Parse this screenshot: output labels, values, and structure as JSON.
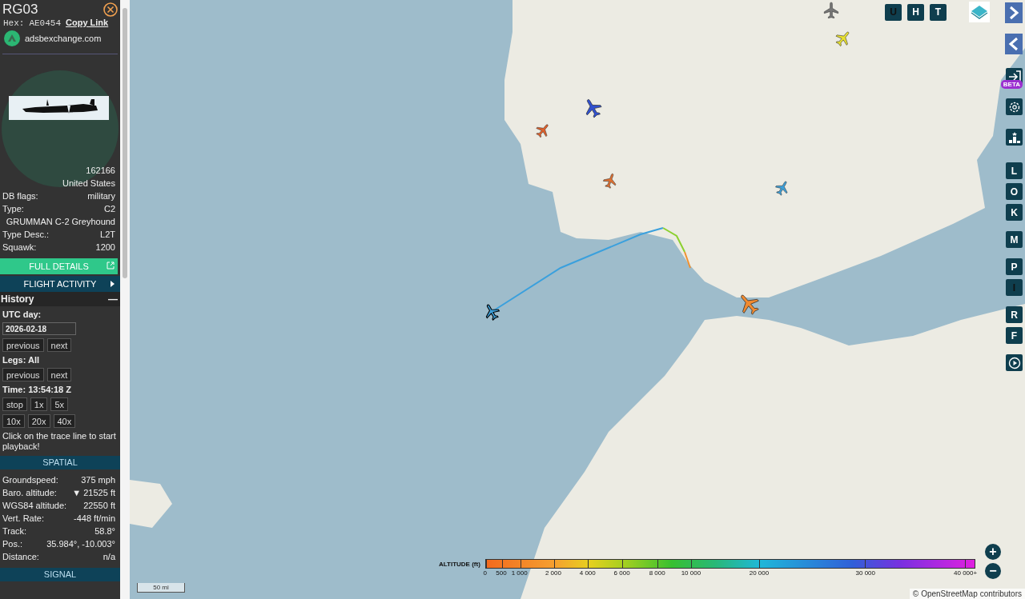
{
  "aircraft": {
    "callsign": "RG03",
    "hex_label": "Hex:",
    "hex": "AE0454",
    "copy_link": "Copy Link",
    "source": "adsbexchange.com"
  },
  "details": [
    {
      "value": "162166"
    },
    {
      "value": "United States"
    },
    {
      "label": "DB flags:",
      "value": "military"
    },
    {
      "label": "Type:",
      "value": "C2"
    },
    {
      "value": "GRUMMAN C-2 Greyhound"
    },
    {
      "label": "Type Desc.:",
      "value": "L2T"
    },
    {
      "label": "Squawk:",
      "value": "1200"
    }
  ],
  "full_details": "FULL DETAILS",
  "flight_activity": "FLIGHT ACTIVITY",
  "history": {
    "title": "History",
    "collapse": "—",
    "utc_label": "UTC day:",
    "date": "2026-02-18",
    "day_buttons": [
      "previous",
      "next"
    ],
    "legs": "Legs: All",
    "leg_buttons": [
      "previous",
      "next"
    ],
    "time": "Time: 13:54:18 Z",
    "speed_rows": [
      [
        "stop",
        "1x",
        "5x"
      ],
      [
        "10x",
        "20x",
        "40x"
      ]
    ],
    "hint": "Click on the trace line to start playback!"
  },
  "spatial": {
    "title": "SPATIAL",
    "rows": [
      {
        "label": "Groundspeed:",
        "value": "375 mph"
      },
      {
        "label": "Baro. altitude:",
        "value": "▼ 21525 ft"
      },
      {
        "label": "WGS84 altitude:",
        "value": "22550 ft"
      },
      {
        "label": "Vert. Rate:",
        "value": "-448 ft/min"
      },
      {
        "label": "Track:",
        "value": "58.8°"
      },
      {
        "label": "Pos.:",
        "value": "35.984°, -10.003°"
      },
      {
        "label": "Distance:",
        "value": "n/a"
      }
    ]
  },
  "signal_title": "SIGNAL",
  "map_buttons": [
    {
      "label": "U",
      "active": false
    },
    {
      "label": "H",
      "active": true
    },
    {
      "label": "T",
      "active": true
    }
  ],
  "side_buttons": [
    {
      "kind": "next"
    },
    {
      "kind": "prev"
    },
    {
      "kind": "login",
      "badge": "BETA"
    },
    {
      "kind": "settings"
    },
    {
      "kind": "podium"
    },
    {
      "kind": "letter",
      "label": "L",
      "active": true
    },
    {
      "kind": "letter",
      "label": "O",
      "active": true
    },
    {
      "kind": "letter",
      "label": "K",
      "active": true
    },
    {
      "kind": "letter",
      "label": "M",
      "active": true
    },
    {
      "kind": "letter",
      "label": "P",
      "active": true
    },
    {
      "kind": "letter",
      "label": "I",
      "active": false
    },
    {
      "kind": "letter",
      "label": "R",
      "active": true
    },
    {
      "kind": "letter",
      "label": "F",
      "active": true
    },
    {
      "kind": "replay"
    }
  ],
  "planes": [
    {
      "color": "#3d9fd8",
      "selected": true
    },
    {
      "color": "#3050d0",
      "selected": false
    },
    {
      "color": "#e0602a",
      "selected": false
    },
    {
      "color": "#e07030",
      "selected": false
    },
    {
      "color": "#3d9fd8",
      "selected": false
    },
    {
      "color": "#f08a30",
      "selected": false
    },
    {
      "color": "#e8e030",
      "selected": false
    },
    {
      "color": "#777777",
      "selected": false
    }
  ],
  "altitude_legend": {
    "title": "ALTITUDE (ft)",
    "ticks": [
      "0",
      "500",
      "1 000",
      "2 000",
      "4 000",
      "6 000",
      "8 000",
      "10 000",
      "20 000",
      "30 000",
      "40 000+"
    ]
  },
  "zoom": [
    "+",
    "−"
  ],
  "scale": "50 mi",
  "attribution": {
    "symbol": "©",
    "link": "OpenStreetMap",
    "suffix": "contributors"
  }
}
